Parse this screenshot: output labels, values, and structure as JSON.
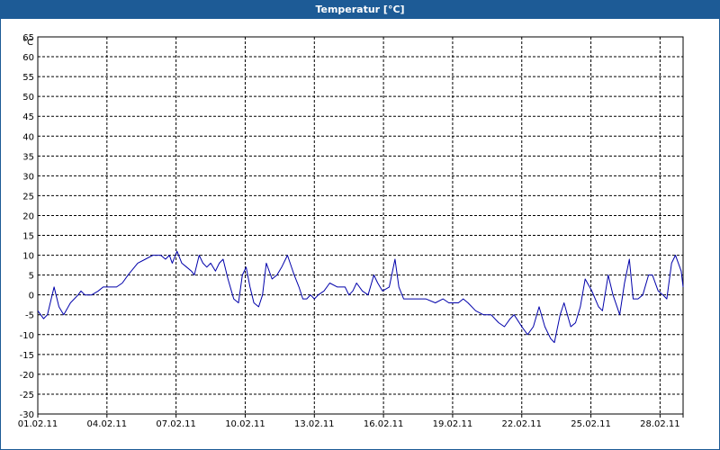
{
  "window": {
    "title": "Temperatur [°C]"
  },
  "chart_data": {
    "type": "line",
    "title": "Temperatur [°C]",
    "ylabel": "°C",
    "xlabel": "",
    "ylim": [
      -30,
      65
    ],
    "y_ticks": [
      65,
      60,
      55,
      50,
      45,
      40,
      35,
      30,
      25,
      20,
      15,
      10,
      5,
      0,
      -5,
      -10,
      -15,
      -20,
      -25,
      -30
    ],
    "xlim": [
      "2011-02-01",
      "2011-03-01"
    ],
    "x_ticks": [
      {
        "x": "2011-02-01",
        "label": "01.02.11"
      },
      {
        "x": "2011-02-04",
        "label": "04.02.11"
      },
      {
        "x": "2011-02-07",
        "label": "07.02.11"
      },
      {
        "x": "2011-02-10",
        "label": "10.02.11"
      },
      {
        "x": "2011-02-13",
        "label": "13.02.11"
      },
      {
        "x": "2011-02-16",
        "label": "16.02.11"
      },
      {
        "x": "2011-02-19",
        "label": "19.02.11"
      },
      {
        "x": "2011-02-22",
        "label": "22.02.11"
      },
      {
        "x": "2011-02-25",
        "label": "25.02.11"
      },
      {
        "x": "2011-02-28",
        "label": "28.02.11"
      }
    ],
    "grid": true,
    "series": [
      {
        "color": "#0000aa",
        "points": [
          [
            "2011-02-01 00:00",
            -4
          ],
          [
            "2011-02-01 06:00",
            -6
          ],
          [
            "2011-02-01 10:00",
            -5
          ],
          [
            "2011-02-01 17:00",
            2
          ],
          [
            "2011-02-01 22:00",
            -3
          ],
          [
            "2011-02-02 03:00",
            -5
          ],
          [
            "2011-02-02 10:00",
            -2
          ],
          [
            "2011-02-02 18:00",
            0
          ],
          [
            "2011-02-02 21:00",
            1
          ],
          [
            "2011-02-03 01:00",
            0
          ],
          [
            "2011-02-03 08:00",
            0
          ],
          [
            "2011-02-03 15:00",
            1
          ],
          [
            "2011-02-03 20:00",
            2
          ],
          [
            "2011-02-04 04:00",
            2
          ],
          [
            "2011-02-04 10:00",
            2
          ],
          [
            "2011-02-04 16:00",
            3
          ],
          [
            "2011-02-04 22:00",
            5
          ],
          [
            "2011-02-05 08:00",
            8
          ],
          [
            "2011-02-05 16:00",
            9
          ],
          [
            "2011-02-06 00:00",
            10
          ],
          [
            "2011-02-06 08:00",
            10
          ],
          [
            "2011-02-06 13:00",
            9
          ],
          [
            "2011-02-06 17:00",
            10
          ],
          [
            "2011-02-06 20:00",
            8
          ],
          [
            "2011-02-07 01:00",
            11
          ],
          [
            "2011-02-07 06:00",
            8
          ],
          [
            "2011-02-07 11:00",
            7
          ],
          [
            "2011-02-07 16:00",
            6
          ],
          [
            "2011-02-07 19:00",
            5
          ],
          [
            "2011-02-08 00:00",
            10
          ],
          [
            "2011-02-08 04:00",
            8
          ],
          [
            "2011-02-08 08:00",
            7
          ],
          [
            "2011-02-08 12:00",
            8
          ],
          [
            "2011-02-08 17:00",
            6
          ],
          [
            "2011-02-08 21:00",
            8
          ],
          [
            "2011-02-09 01:00",
            9
          ],
          [
            "2011-02-09 06:00",
            4
          ],
          [
            "2011-02-09 12:00",
            -1
          ],
          [
            "2011-02-09 17:00",
            -2
          ],
          [
            "2011-02-09 21:00",
            5
          ],
          [
            "2011-02-10 01:00",
            7
          ],
          [
            "2011-02-10 05:00",
            2
          ],
          [
            "2011-02-10 09:00",
            -2
          ],
          [
            "2011-02-10 14:00",
            -3
          ],
          [
            "2011-02-10 18:00",
            0
          ],
          [
            "2011-02-10 22:00",
            8
          ],
          [
            "2011-02-11 04:00",
            4
          ],
          [
            "2011-02-11 09:00",
            5
          ],
          [
            "2011-02-11 14:00",
            7
          ],
          [
            "2011-02-11 20:00",
            10
          ],
          [
            "2011-02-12 03:00",
            5
          ],
          [
            "2011-02-12 08:00",
            2
          ],
          [
            "2011-02-12 12:00",
            -1
          ],
          [
            "2011-02-12 16:00",
            -1
          ],
          [
            "2011-02-12 20:00",
            0
          ],
          [
            "2011-02-13 00:00",
            -1
          ],
          [
            "2011-02-13 04:00",
            0
          ],
          [
            "2011-02-13 10:00",
            1
          ],
          [
            "2011-02-13 16:00",
            3
          ],
          [
            "2011-02-14 00:00",
            2
          ],
          [
            "2011-02-14 08:00",
            2
          ],
          [
            "2011-02-14 12:00",
            0
          ],
          [
            "2011-02-14 16:00",
            1
          ],
          [
            "2011-02-14 20:00",
            3
          ],
          [
            "2011-02-15 02:00",
            1
          ],
          [
            "2011-02-15 08:00",
            0
          ],
          [
            "2011-02-15 14:00",
            5
          ],
          [
            "2011-02-15 18:00",
            3
          ],
          [
            "2011-02-15 23:00",
            1
          ],
          [
            "2011-02-16 06:00",
            2
          ],
          [
            "2011-02-16 12:00",
            9
          ],
          [
            "2011-02-16 16:00",
            2
          ],
          [
            "2011-02-16 21:00",
            -1
          ],
          [
            "2011-02-17 05:00",
            -1
          ],
          [
            "2011-02-17 12:00",
            -1
          ],
          [
            "2011-02-17 20:00",
            -1
          ],
          [
            "2011-02-18 06:00",
            -2
          ],
          [
            "2011-02-18 14:00",
            -1
          ],
          [
            "2011-02-18 20:00",
            -2
          ],
          [
            "2011-02-19 06:00",
            -2
          ],
          [
            "2011-02-19 11:00",
            -1
          ],
          [
            "2011-02-19 16:00",
            -2
          ],
          [
            "2011-02-20 00:00",
            -4
          ],
          [
            "2011-02-20 08:00",
            -5
          ],
          [
            "2011-02-20 16:00",
            -5
          ],
          [
            "2011-02-21 00:00",
            -7
          ],
          [
            "2011-02-21 06:00",
            -8
          ],
          [
            "2011-02-21 12:00",
            -6
          ],
          [
            "2011-02-21 16:00",
            -5
          ],
          [
            "2011-02-22 00:00",
            -8
          ],
          [
            "2011-02-22 06:00",
            -10
          ],
          [
            "2011-02-22 12:00",
            -8
          ],
          [
            "2011-02-22 18:00",
            -3
          ],
          [
            "2011-02-23 00:00",
            -8
          ],
          [
            "2011-02-23 06:00",
            -11
          ],
          [
            "2011-02-23 10:00",
            -12
          ],
          [
            "2011-02-23 16:00",
            -5
          ],
          [
            "2011-02-23 20:00",
            -2
          ],
          [
            "2011-02-24 03:00",
            -8
          ],
          [
            "2011-02-24 08:00",
            -7
          ],
          [
            "2011-02-24 13:00",
            -3
          ],
          [
            "2011-02-24 18:00",
            4
          ],
          [
            "2011-02-25 01:00",
            1
          ],
          [
            "2011-02-25 08:00",
            -3
          ],
          [
            "2011-02-25 12:00",
            -4
          ],
          [
            "2011-02-25 18:00",
            5
          ],
          [
            "2011-02-25 23:00",
            0
          ],
          [
            "2011-02-26 06:00",
            -5
          ],
          [
            "2011-02-26 11:00",
            3
          ],
          [
            "2011-02-26 16:00",
            9
          ],
          [
            "2011-02-26 20:00",
            -1
          ],
          [
            "2011-02-27 01:00",
            -1
          ],
          [
            "2011-02-27 06:00",
            0
          ],
          [
            "2011-02-27 12:00",
            5
          ],
          [
            "2011-02-27 16:00",
            5
          ],
          [
            "2011-02-27 22:00",
            1
          ],
          [
            "2011-02-28 03:00",
            0
          ],
          [
            "2011-02-28 07:00",
            -1
          ],
          [
            "2011-02-28 12:00",
            8
          ],
          [
            "2011-02-28 16:00",
            10
          ],
          [
            "2011-02-28 22:00",
            6
          ],
          [
            "2011-03-01 00:00",
            2
          ]
        ]
      }
    ]
  }
}
